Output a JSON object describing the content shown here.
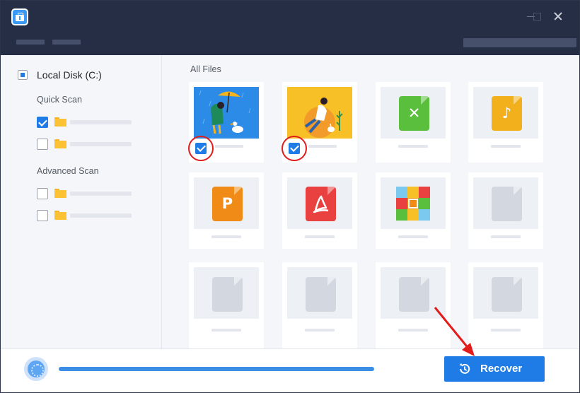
{
  "titlebar": {
    "icon": "toolbox-icon",
    "menu_placeholders": 2,
    "window_controls": [
      "minimize-icon",
      "maximize-icon",
      "close-icon"
    ]
  },
  "sidebar": {
    "disk_label": "Local Disk (C:)",
    "quick_scan_label": "Quick Scan",
    "advanced_scan_label": "Advanced Scan",
    "quick_scan_items": [
      {
        "checked": true
      },
      {
        "checked": false
      }
    ],
    "advanced_scan_items": [
      {
        "checked": false
      },
      {
        "checked": false
      }
    ]
  },
  "main": {
    "title": "All Files",
    "tiles": [
      {
        "kind": "image",
        "subject": "person-with-umbrella-and-goose",
        "checked": true
      },
      {
        "kind": "image",
        "subject": "person-sitting-with-rabbit",
        "checked": true
      },
      {
        "kind": "excel-file",
        "glyph": "X",
        "color": "#5bbf3e"
      },
      {
        "kind": "music-file",
        "glyph": "♪",
        "color": "#f2b11c"
      },
      {
        "kind": "powerpoint-file",
        "glyph": "P",
        "color": "#f18b17"
      },
      {
        "kind": "pdf-file",
        "glyph": "pdf",
        "color": "#e8413f"
      },
      {
        "kind": "archive-file",
        "glyph": "",
        "color": "#7cc9f0"
      },
      {
        "kind": "blank-file",
        "color": "#d3d8e0"
      },
      {
        "kind": "blank-file",
        "color": "#d3d8e0"
      },
      {
        "kind": "blank-file",
        "color": "#d3d8e0"
      },
      {
        "kind": "blank-file",
        "color": "#d3d8e0"
      },
      {
        "kind": "blank-file",
        "color": "#d3d8e0"
      }
    ]
  },
  "bottombar": {
    "scan_icon": "fingerprint-scan-icon",
    "progress": 1.0,
    "recover_label": "Recover",
    "recover_icon": "history-icon"
  },
  "colors": {
    "titlebar": "#252e44",
    "accent": "#1f7ce6",
    "highlight_ring": "#e21b1b"
  }
}
